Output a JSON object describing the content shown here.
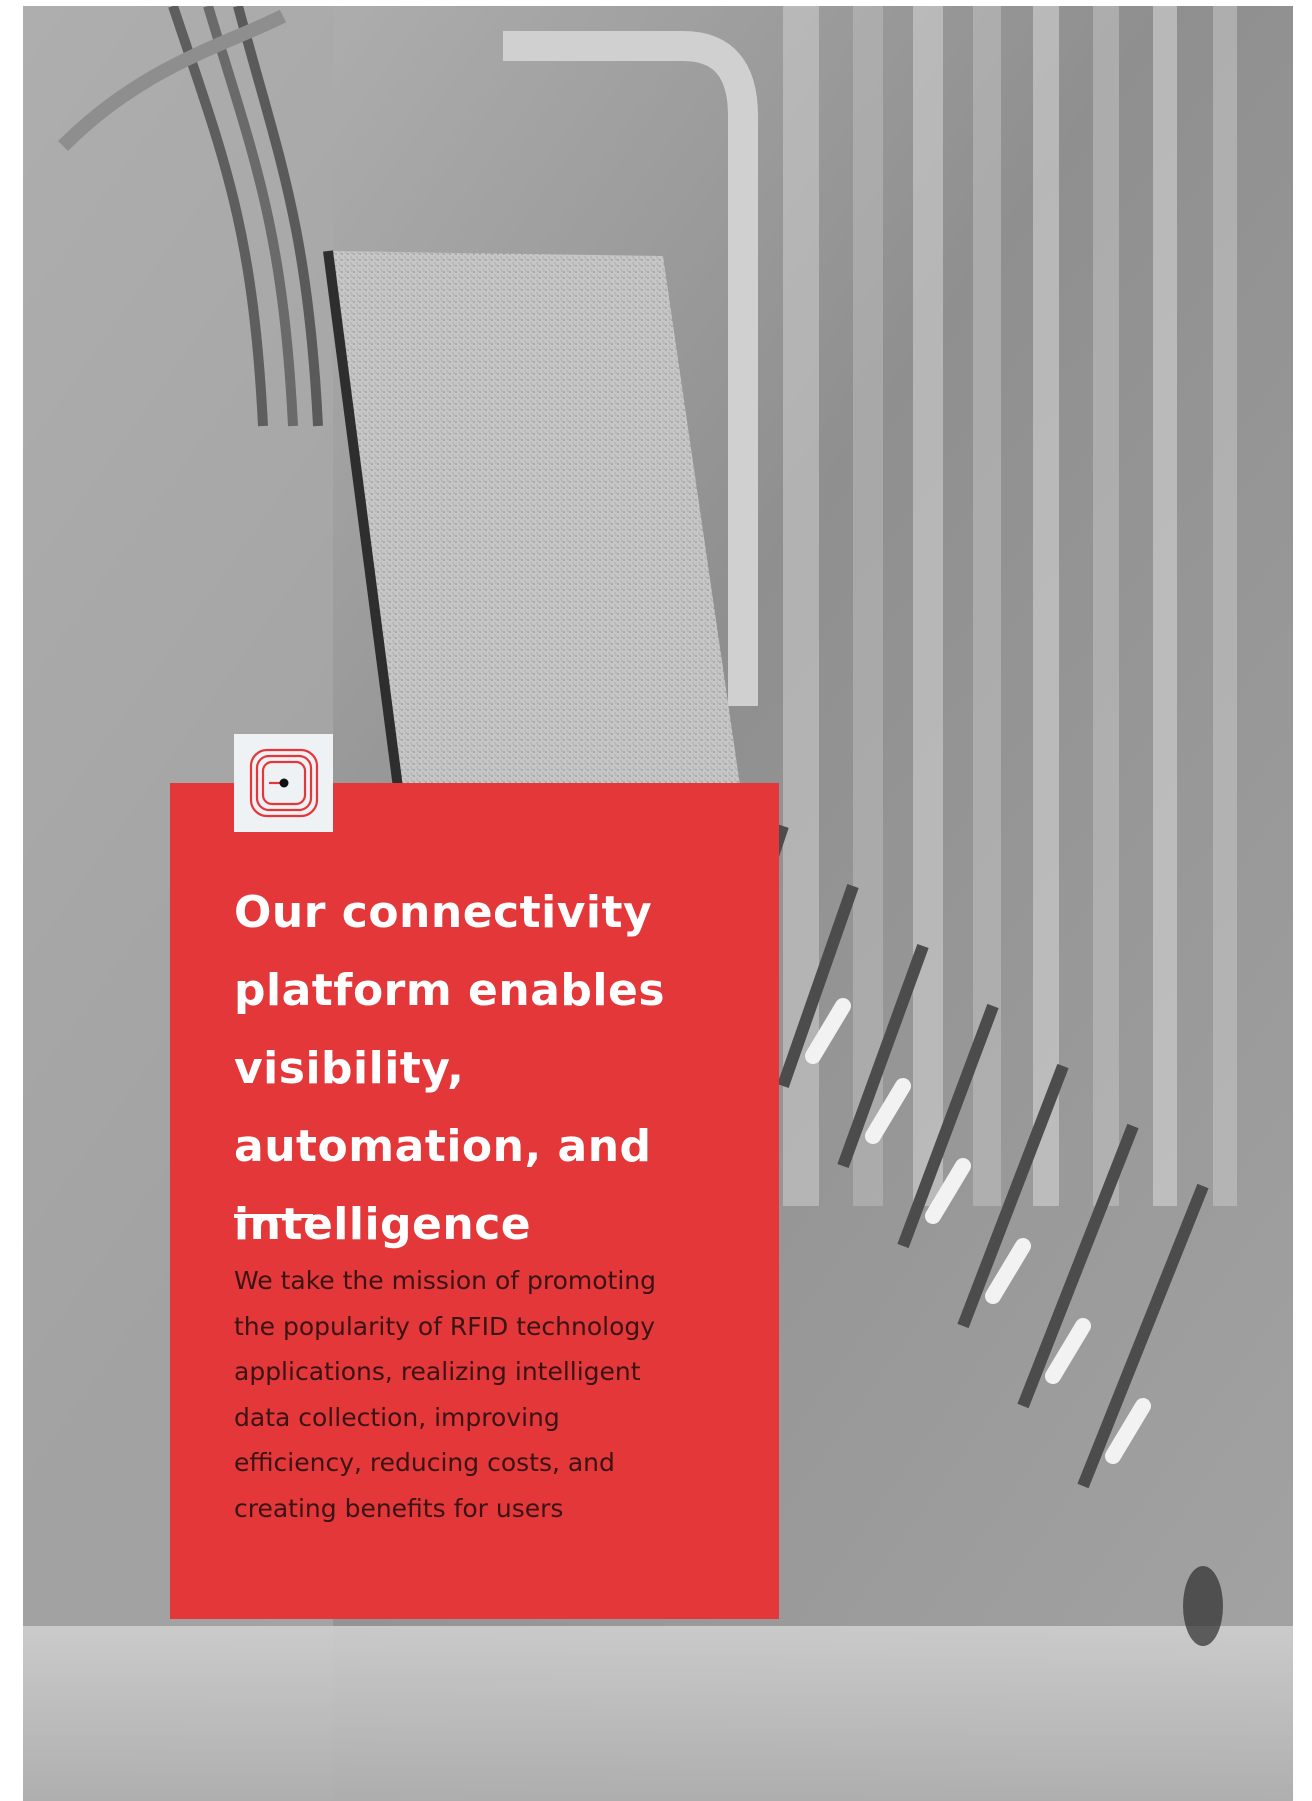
{
  "hero": {
    "image_description_icon": "rfid-chip-macro-photo",
    "card_color": "#e3373a",
    "badge_icon": "rfid-tag-icon",
    "headline": "Our connectivity platform enables visibility, automation, and intelligence",
    "body": "We take the mission of promoting the popularity of RFID technology applications, realizing intelligent data collection, improving efficiency, reducing costs, and creating benefits for users"
  }
}
